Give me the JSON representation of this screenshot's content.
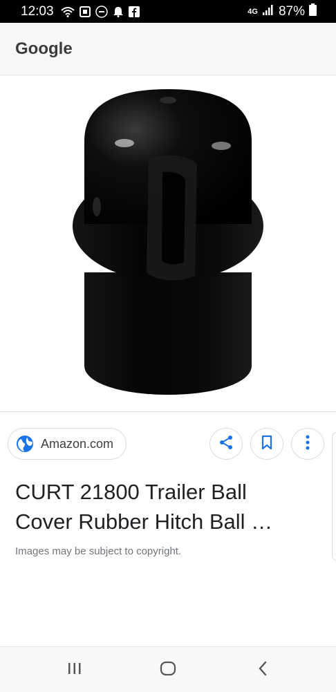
{
  "status_bar": {
    "time": "12:03",
    "network": "4G",
    "battery": "87%",
    "icons": [
      "wifi-icon",
      "camera-app-icon",
      "minus-circle-icon",
      "bell-icon",
      "facebook-icon",
      "signal-icon",
      "battery-icon"
    ]
  },
  "app_bar": {
    "title": "Google"
  },
  "image": {
    "description_icon": "hitch-ball-cover-image"
  },
  "source": {
    "label": "Amazon.com",
    "icon": "globe-icon"
  },
  "actions": {
    "share_icon": "share-icon",
    "bookmark_icon": "bookmark-icon",
    "more_icon": "more-vert-icon"
  },
  "result": {
    "title": "CURT 21800 Trailer Ball Cover Rubber Hitch Ball …",
    "copyright": "Images may be subject to copyright."
  },
  "nav": {
    "recents_icon": "recents-icon",
    "home_icon": "home-icon",
    "back_icon": "back-icon"
  },
  "colors": {
    "accent": "#1a73e8",
    "status_bar": "#000000",
    "app_bar": "#f7f7f7"
  }
}
